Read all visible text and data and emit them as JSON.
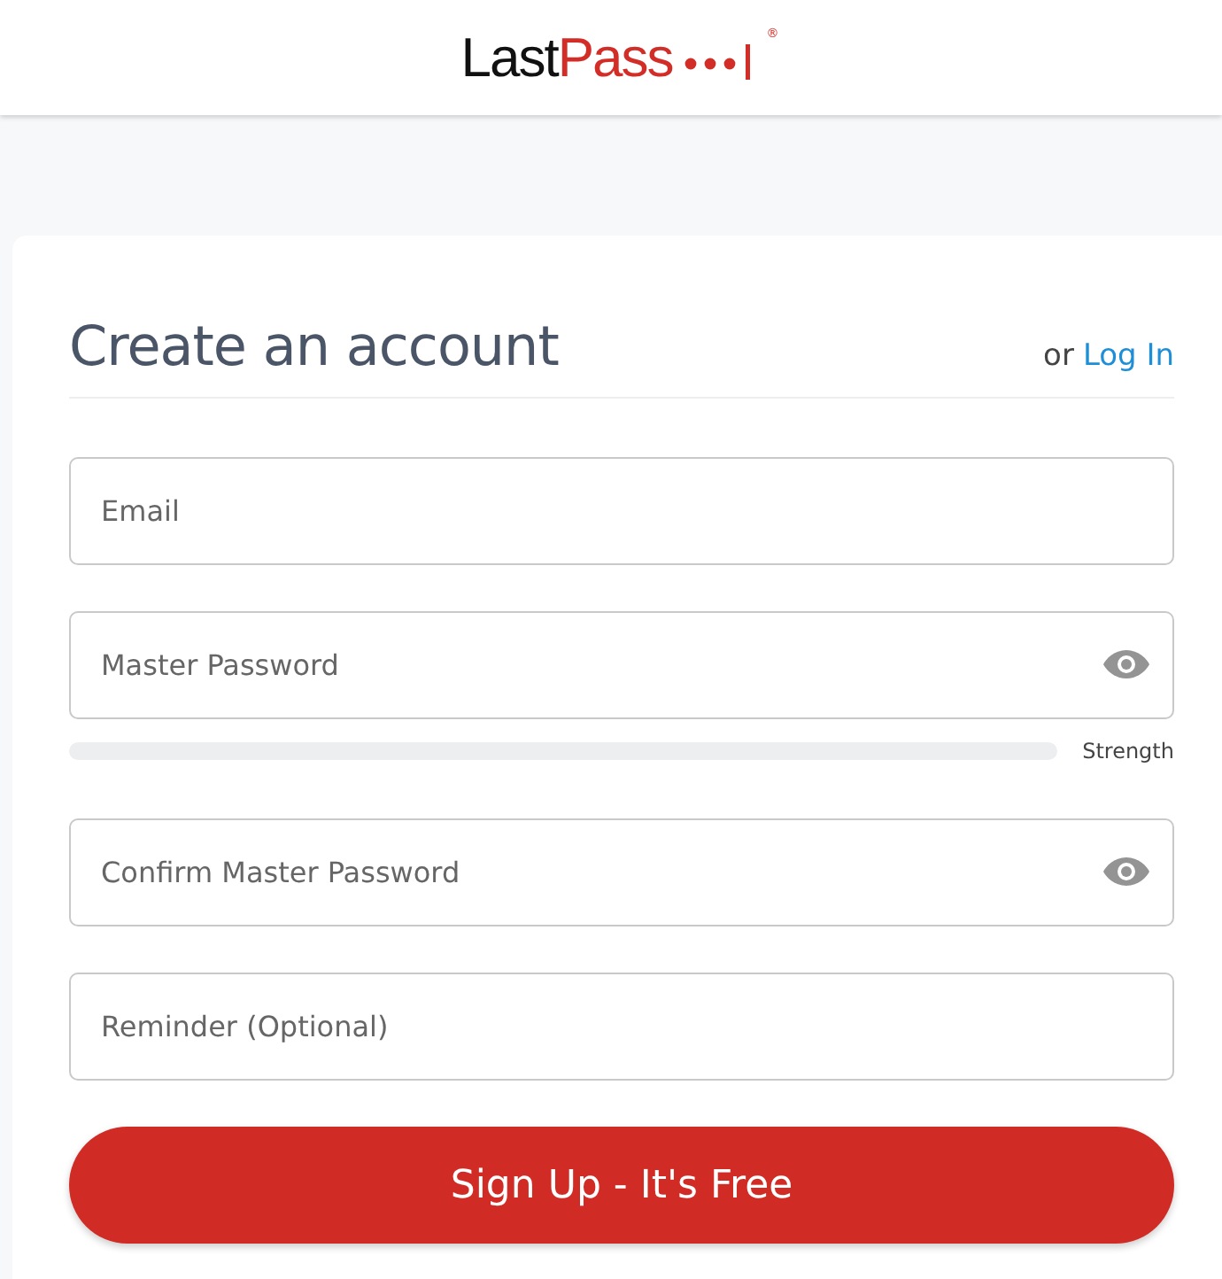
{
  "logo": {
    "text": "Last",
    "accent": "Pass",
    "mark": "®"
  },
  "form": {
    "title": "Create an account",
    "alt_prefix": "or",
    "alt_link": "Log In",
    "fields": [
      {
        "kind": "text",
        "placeholder": "Email"
      },
      {
        "kind": "password",
        "placeholder": "Master Password",
        "strength": {
          "level": 0,
          "label": "Strength"
        }
      },
      {
        "kind": "password",
        "placeholder": "Confirm Master Password"
      },
      {
        "kind": "text",
        "placeholder": "Reminder (Optional)"
      }
    ],
    "submit": "Sign Up - It's Free"
  }
}
